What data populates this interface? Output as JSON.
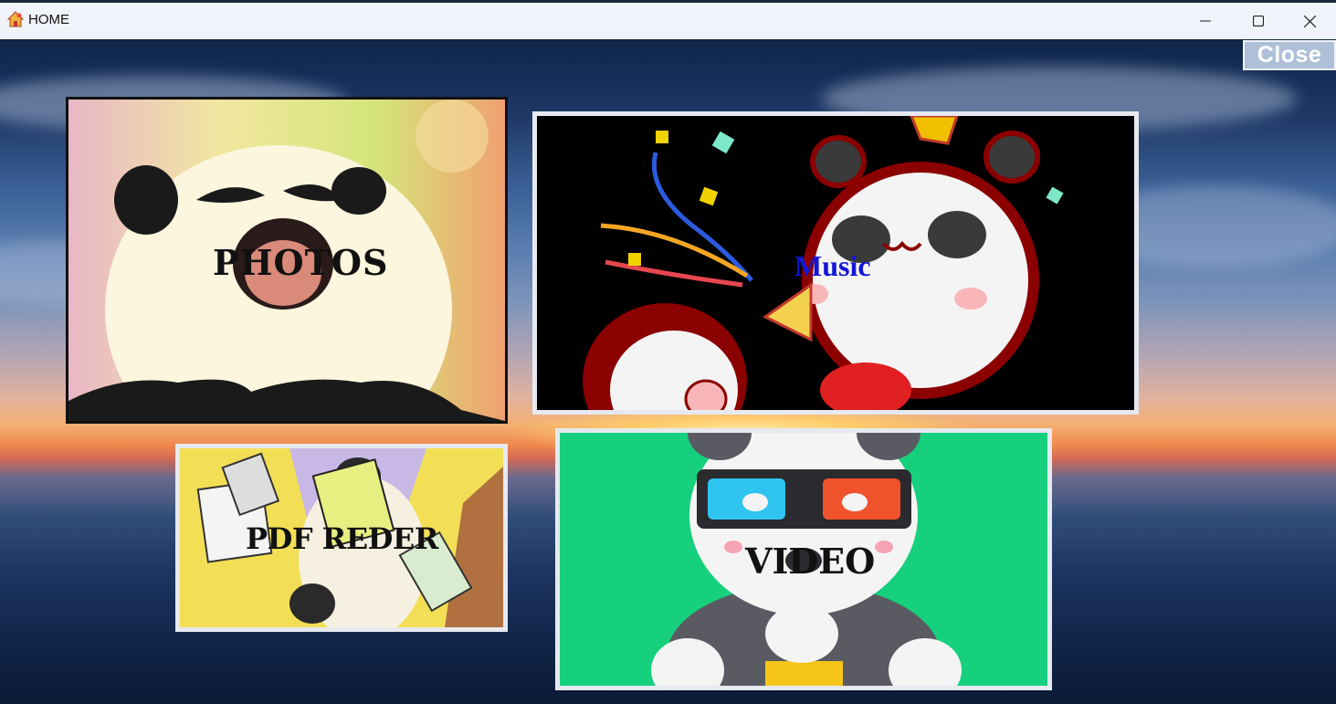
{
  "window": {
    "title": "HOME",
    "minimize_icon": "minimize-icon",
    "maximize_icon": "maximize-icon",
    "close_icon": "close-icon"
  },
  "close_button": {
    "label": "Close"
  },
  "tiles": {
    "photos": {
      "label": "PHOTOS",
      "label_color": "#111111"
    },
    "music": {
      "label": "Music",
      "label_color": "#1515d6"
    },
    "pdf": {
      "label": "PDF REDER",
      "label_color": "#111111"
    },
    "video": {
      "label": "VIDEO",
      "label_color": "#111111"
    }
  },
  "colors": {
    "video_background": "#16d07e",
    "music_background": "#000000",
    "pdf_background": "#f3df55"
  }
}
